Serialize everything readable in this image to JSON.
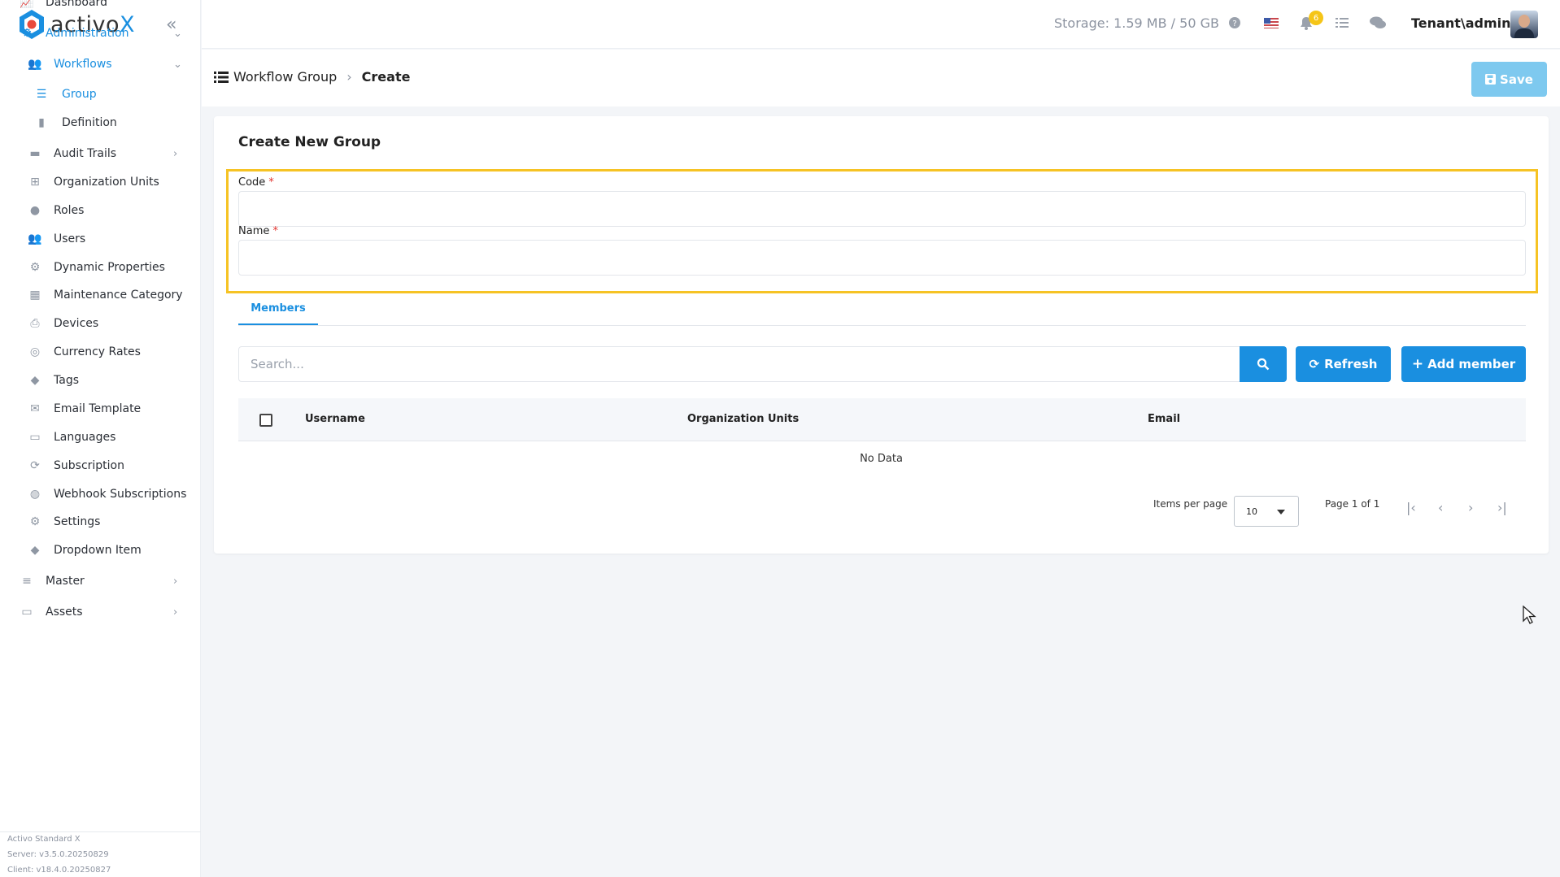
{
  "brand": {
    "logo_prefix": "activo",
    "logo_suffix": "X",
    "accent": "#1a8fe0",
    "highlight": "#f6c324"
  },
  "sidebar": {
    "items": [
      {
        "label": "Dashboard",
        "icon": "chart-line-icon"
      },
      {
        "label": "Administration",
        "icon": "cogs-icon"
      },
      {
        "label": "Workflows",
        "icon": "users-icon"
      },
      {
        "label": "Group",
        "icon": "list-icon"
      },
      {
        "label": "Definition",
        "icon": "clipboard-icon"
      },
      {
        "label": "Audit Trails",
        "icon": "folder-icon"
      },
      {
        "label": "Organization Units",
        "icon": "sitemap-icon"
      },
      {
        "label": "Roles",
        "icon": "user-tag-icon"
      },
      {
        "label": "Users",
        "icon": "users-icon"
      },
      {
        "label": "Dynamic Properties",
        "icon": "gear-icon"
      },
      {
        "label": "Maintenance Category",
        "icon": "grid-icon"
      },
      {
        "label": "Devices",
        "icon": "printer-icon"
      },
      {
        "label": "Currency Rates",
        "icon": "coins-icon"
      },
      {
        "label": "Tags",
        "icon": "tags-icon"
      },
      {
        "label": "Email Template",
        "icon": "envelope-icon"
      },
      {
        "label": "Languages",
        "icon": "language-icon"
      },
      {
        "label": "Subscription",
        "icon": "sync-icon"
      },
      {
        "label": "Webhook Subscriptions",
        "icon": "globe-icon"
      },
      {
        "label": "Settings",
        "icon": "gear-icon"
      },
      {
        "label": "Dropdown Item",
        "icon": "tags-icon"
      },
      {
        "label": "Master",
        "icon": "database-icon"
      },
      {
        "label": "Assets",
        "icon": "laptop-icon"
      }
    ],
    "footer": {
      "product": "Activo Standard X",
      "server": "Server: v3.5.0.20250829",
      "client": "Client: v18.4.0.20250827"
    }
  },
  "topbar": {
    "storage": "Storage: 1.59 MB / 50 GB",
    "notification_count": "6",
    "user": "Tenant\\admin"
  },
  "breadcrumb": {
    "parent": "Workflow Group",
    "current": "Create"
  },
  "toolbar": {
    "save_label": "Save"
  },
  "form": {
    "title": "Create New Group",
    "code_label": "Code",
    "code_value": "",
    "name_label": "Name",
    "name_value": "",
    "required_mark": "*"
  },
  "members": {
    "tab_label": "Members",
    "search_placeholder": "Search...",
    "refresh_label": "Refresh",
    "add_label": "Add member",
    "columns": [
      "Username",
      "Organization Units",
      "Email"
    ],
    "empty_text": "No Data",
    "items_per_page_label": "Items per page",
    "items_per_page": "10",
    "page_text": "Page 1 of 1"
  }
}
